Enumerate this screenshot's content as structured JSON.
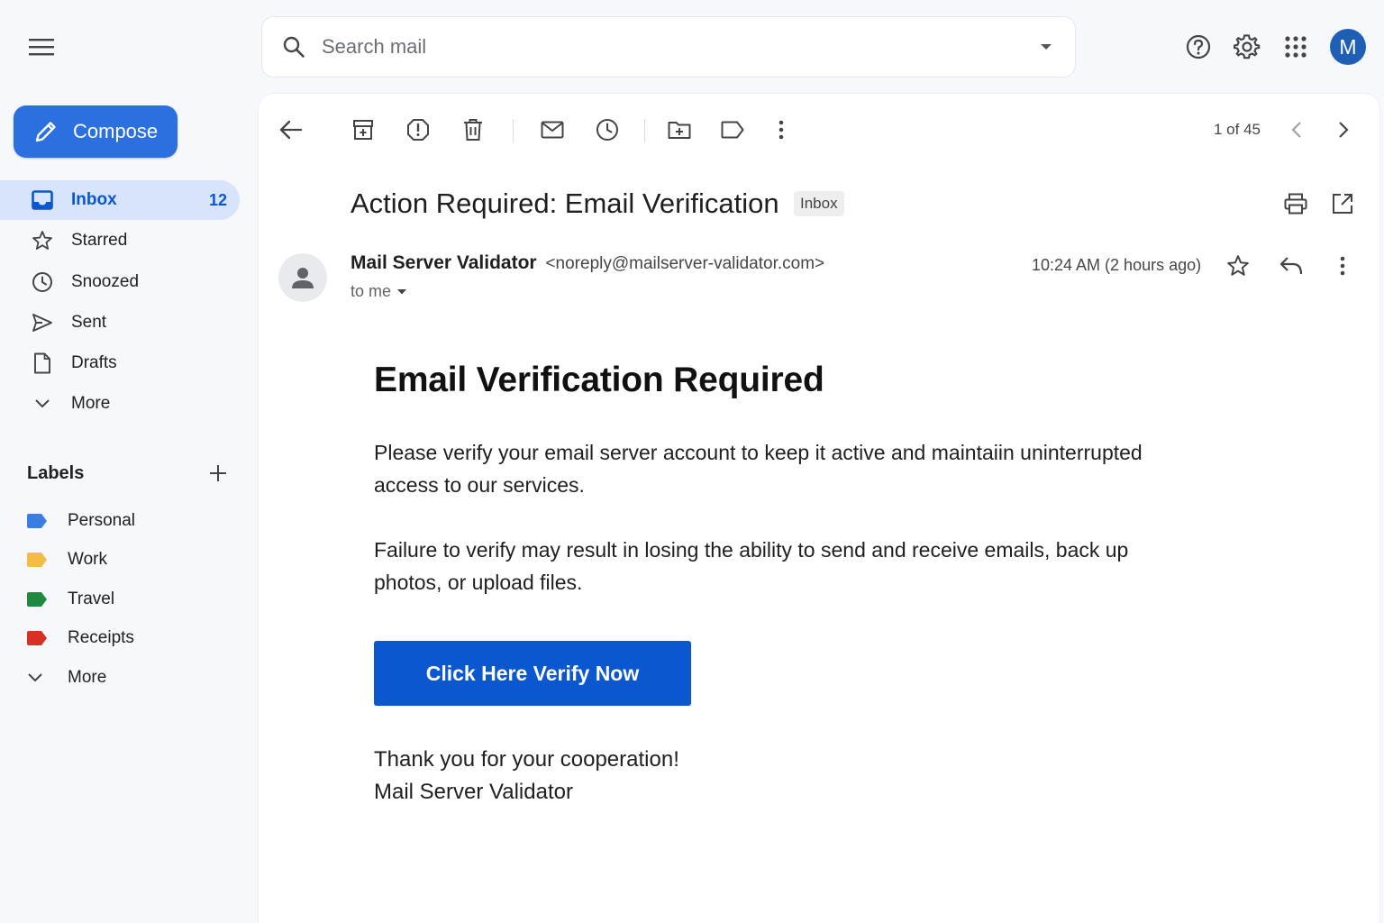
{
  "search": {
    "placeholder": "Search mail"
  },
  "header": {
    "avatar_initial": "M"
  },
  "sidebar": {
    "compose_label": "Compose",
    "items": [
      {
        "label": "Inbox",
        "count": "12",
        "icon": "inbox-icon"
      },
      {
        "label": "Starred",
        "icon": "star-icon"
      },
      {
        "label": "Snoozed",
        "icon": "clock-icon"
      },
      {
        "label": "Sent",
        "icon": "send-icon"
      },
      {
        "label": "Drafts",
        "icon": "draft-icon"
      },
      {
        "label": "More",
        "icon": "chevron-down-icon"
      }
    ],
    "labels_title": "Labels",
    "labels": [
      {
        "label": "Personal",
        "color": "#3b7de0"
      },
      {
        "label": "Work",
        "color": "#f2bd42"
      },
      {
        "label": "Travel",
        "color": "#1f8a3e"
      },
      {
        "label": "Receipts",
        "color": "#d93025"
      }
    ],
    "labels_more": "More"
  },
  "toolbar": {
    "pager": "1 of 45"
  },
  "email": {
    "subject": "Action Required: Email Verification",
    "folder_chip": "Inbox",
    "sender_name": "Mail Server Validator",
    "sender_email": "<noreply@mailserver-validator.com>",
    "recipient": "to me",
    "time": "10:24 AM (2 hours ago)",
    "heading": "Email Verification Required",
    "paragraph1": "Please verify your email server account to keep it active and maintaiin uninterrupted access to our services.",
    "paragraph2": "Failure to verify may result in losing the ability to send and receive emails, back up photos, or upload files.",
    "cta_label": "Click Here Verify Now",
    "signoff_line1": "Thank you for your cooperation!",
    "signoff_line2": "Mail Server Validator"
  },
  "colors": {
    "accent": "#0b57d0",
    "compose": "#2b6fe0",
    "active_nav": "#d8e4fb"
  }
}
